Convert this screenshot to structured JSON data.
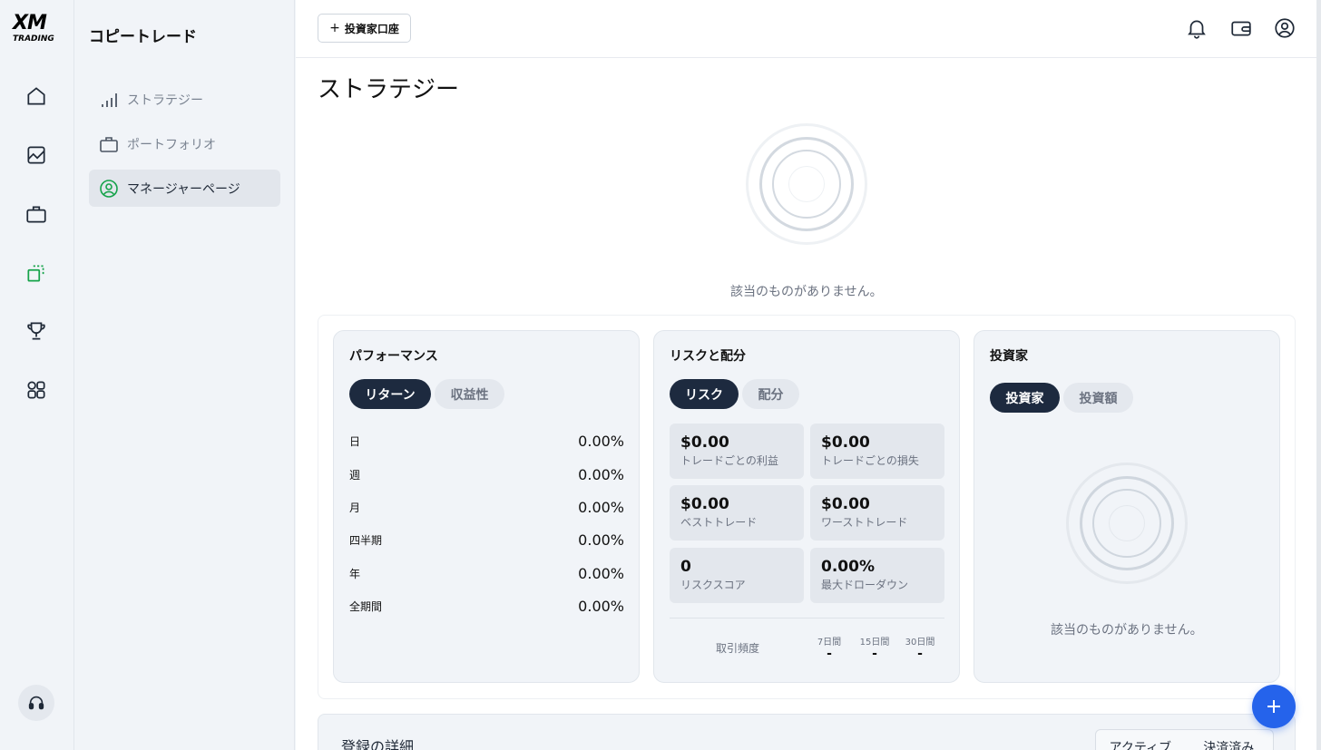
{
  "brand": {
    "logo_main": "XM",
    "logo_sub": "TRADING"
  },
  "sidebar": {
    "title": "コピートレード",
    "items": [
      {
        "label": "ストラテジー",
        "icon": "bar-chart-icon"
      },
      {
        "label": "ポートフォリオ",
        "icon": "briefcase-icon"
      },
      {
        "label": "マネージャーページ",
        "icon": "user-circle-icon",
        "active": true
      }
    ]
  },
  "topbar": {
    "add_investor_label": "投資家口座"
  },
  "main": {
    "title": "ストラテジー",
    "empty_text": "該当のものがありません。"
  },
  "performance": {
    "title": "パフォーマンス",
    "tabs": [
      "リターン",
      "収益性"
    ],
    "rows": [
      {
        "label": "日",
        "value": "0.00%"
      },
      {
        "label": "週",
        "value": "0.00%"
      },
      {
        "label": "月",
        "value": "0.00%"
      },
      {
        "label": "四半期",
        "value": "0.00%"
      },
      {
        "label": "年",
        "value": "0.00%"
      },
      {
        "label": "全期間",
        "value": "0.00%"
      }
    ]
  },
  "risk": {
    "title": "リスクと配分",
    "tabs": [
      "リスク",
      "配分"
    ],
    "stats": [
      {
        "value": "$0.00",
        "label": "トレードごとの利益"
      },
      {
        "value": "$0.00",
        "label": "トレードごとの損失"
      },
      {
        "value": "$0.00",
        "label": "ベストトレード"
      },
      {
        "value": "$0.00",
        "label": "ワーストトレード"
      },
      {
        "value": "0",
        "label": "リスクスコア"
      },
      {
        "value": "0.00%",
        "label": "最大ドローダウン"
      }
    ],
    "frequency_label": "取引頻度",
    "frequency": [
      {
        "period": "7日間",
        "value": "-"
      },
      {
        "period": "15日間",
        "value": "-"
      },
      {
        "period": "30日間",
        "value": "-"
      }
    ]
  },
  "investors": {
    "title": "投資家",
    "tabs": [
      "投資家",
      "投資額"
    ],
    "empty_text": "該当のものがありません。"
  },
  "registration": {
    "title": "登録の詳細",
    "segments": [
      "アクティブ",
      "決済済み"
    ]
  },
  "colors": {
    "accent": "#2563eb",
    "active_green": "#16a34a",
    "dark_pill": "#1d2a3f"
  }
}
